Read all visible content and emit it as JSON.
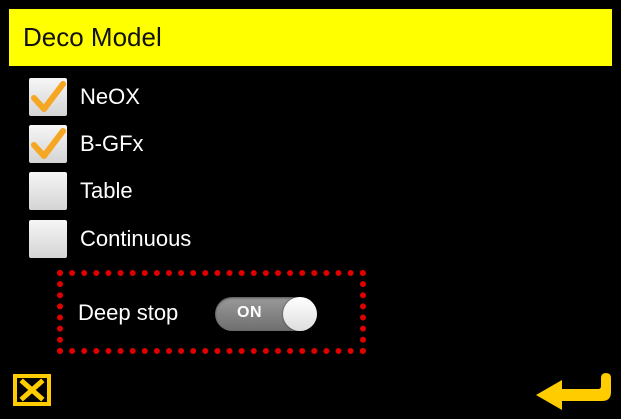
{
  "header": {
    "title": "Deco Model"
  },
  "options": [
    {
      "label": "NeOX",
      "checked": true
    },
    {
      "label": "B-GFx",
      "checked": true
    },
    {
      "label": "Table",
      "checked": false
    },
    {
      "label": "Continuous",
      "checked": false
    }
  ],
  "deep_stop": {
    "label": "Deep stop",
    "toggle_text": "ON",
    "state": "on"
  },
  "footer": {
    "cancel_icon": "close-icon",
    "enter_icon": "return-arrow-icon"
  },
  "colors": {
    "header_bg": "#ffff00",
    "accent": "#ffcc00",
    "checkmark": "#f5a623",
    "highlight_border": "#e00000",
    "background": "#000000"
  }
}
